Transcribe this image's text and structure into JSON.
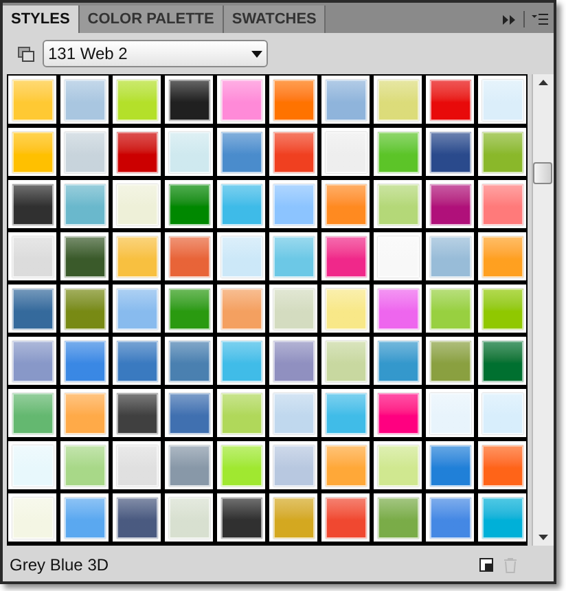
{
  "tabs": [
    {
      "label": "STYLES",
      "selected": true
    },
    {
      "label": "COLOR PALETTE",
      "selected": false
    },
    {
      "label": "SWATCHES",
      "selected": false
    }
  ],
  "style_set": {
    "value": "131 Web 2"
  },
  "styles": [
    {
      "color": "#ffc933"
    },
    {
      "color": "#a9c6e0"
    },
    {
      "color": "#b4e02a"
    },
    {
      "color": "#202020"
    },
    {
      "color": "#ff8ad8"
    },
    {
      "color": "#ff7300"
    },
    {
      "color": "#8fb4db"
    },
    {
      "color": "#dcdc7a"
    },
    {
      "color": "#e80a0a"
    },
    {
      "color": "#dbeefa"
    },
    {
      "color": "#ffc000"
    },
    {
      "color": "#c8d4dc"
    },
    {
      "color": "#cc0000"
    },
    {
      "color": "#cfe9ef"
    },
    {
      "color": "#4a8ccc"
    },
    {
      "color": "#f04020"
    },
    {
      "color": "#eeeeee"
    },
    {
      "color": "#5cc428"
    },
    {
      "color": "#2a4a8c"
    },
    {
      "color": "#8ab82a"
    },
    {
      "color": "#303030"
    },
    {
      "color": "#6ab8cc"
    },
    {
      "color": "#eef0d8"
    },
    {
      "color": "#008800"
    },
    {
      "color": "#3ebbe8"
    },
    {
      "color": "#8cc4ff"
    },
    {
      "color": "#ff8a20"
    },
    {
      "color": "#b4d878"
    },
    {
      "color": "#b0107a"
    },
    {
      "color": "#ff7a7a"
    },
    {
      "color": "#dcdcdc"
    },
    {
      "color": "#3a5a2a"
    },
    {
      "color": "#f8c040"
    },
    {
      "color": "#e86438"
    },
    {
      "color": "#cce8f8"
    },
    {
      "color": "#6cc8e6"
    },
    {
      "color": "#f0288a"
    },
    {
      "color": "#f8f8f8"
    },
    {
      "color": "#98bcd8"
    },
    {
      "color": "#ffa020"
    },
    {
      "color": "#356a9c"
    },
    {
      "color": "#788a14"
    },
    {
      "color": "#88bbee"
    },
    {
      "color": "#2a9a10"
    },
    {
      "color": "#f4a060"
    },
    {
      "color": "#d4dcc0"
    },
    {
      "color": "#f8e888"
    },
    {
      "color": "#ee66ee"
    },
    {
      "color": "#98d040"
    },
    {
      "color": "#90c800"
    },
    {
      "color": "#8898c8"
    },
    {
      "color": "#3a88e4"
    },
    {
      "color": "#3a7ac0"
    },
    {
      "color": "#4a80b0"
    },
    {
      "color": "#40bce8"
    },
    {
      "color": "#9090c0"
    },
    {
      "color": "#c8d8a0"
    },
    {
      "color": "#3498cc"
    },
    {
      "color": "#8aa040"
    },
    {
      "color": "#007030"
    },
    {
      "color": "#64b870"
    },
    {
      "color": "#ffaa48"
    },
    {
      "color": "#404040"
    },
    {
      "color": "#4070b0"
    },
    {
      "color": "#b0d85a"
    },
    {
      "color": "#c0d8ee"
    },
    {
      "color": "#40bce8"
    },
    {
      "color": "#ff0080"
    },
    {
      "color": "#e8f4fc"
    },
    {
      "color": "#d8eefc"
    },
    {
      "color": "#e8f8fc"
    },
    {
      "color": "#a8d888"
    },
    {
      "color": "#e0e0e0"
    },
    {
      "color": "#8898a8"
    },
    {
      "color": "#a0e830"
    },
    {
      "color": "#b8c8e0"
    },
    {
      "color": "#ffa838"
    },
    {
      "color": "#d0e890"
    },
    {
      "color": "#2080d8"
    },
    {
      "color": "#ff6418"
    },
    {
      "color": "#f4f6e4"
    },
    {
      "color": "#5aa8f0"
    },
    {
      "color": "#4a5a80"
    },
    {
      "color": "#d8e0d0"
    },
    {
      "color": "#303030"
    },
    {
      "color": "#d4a820"
    },
    {
      "color": "#f04830"
    },
    {
      "color": "#7aac48"
    },
    {
      "color": "#4488e4"
    },
    {
      "color": "#00b0d8"
    }
  ],
  "status": {
    "text": "Grey Blue 3D"
  }
}
